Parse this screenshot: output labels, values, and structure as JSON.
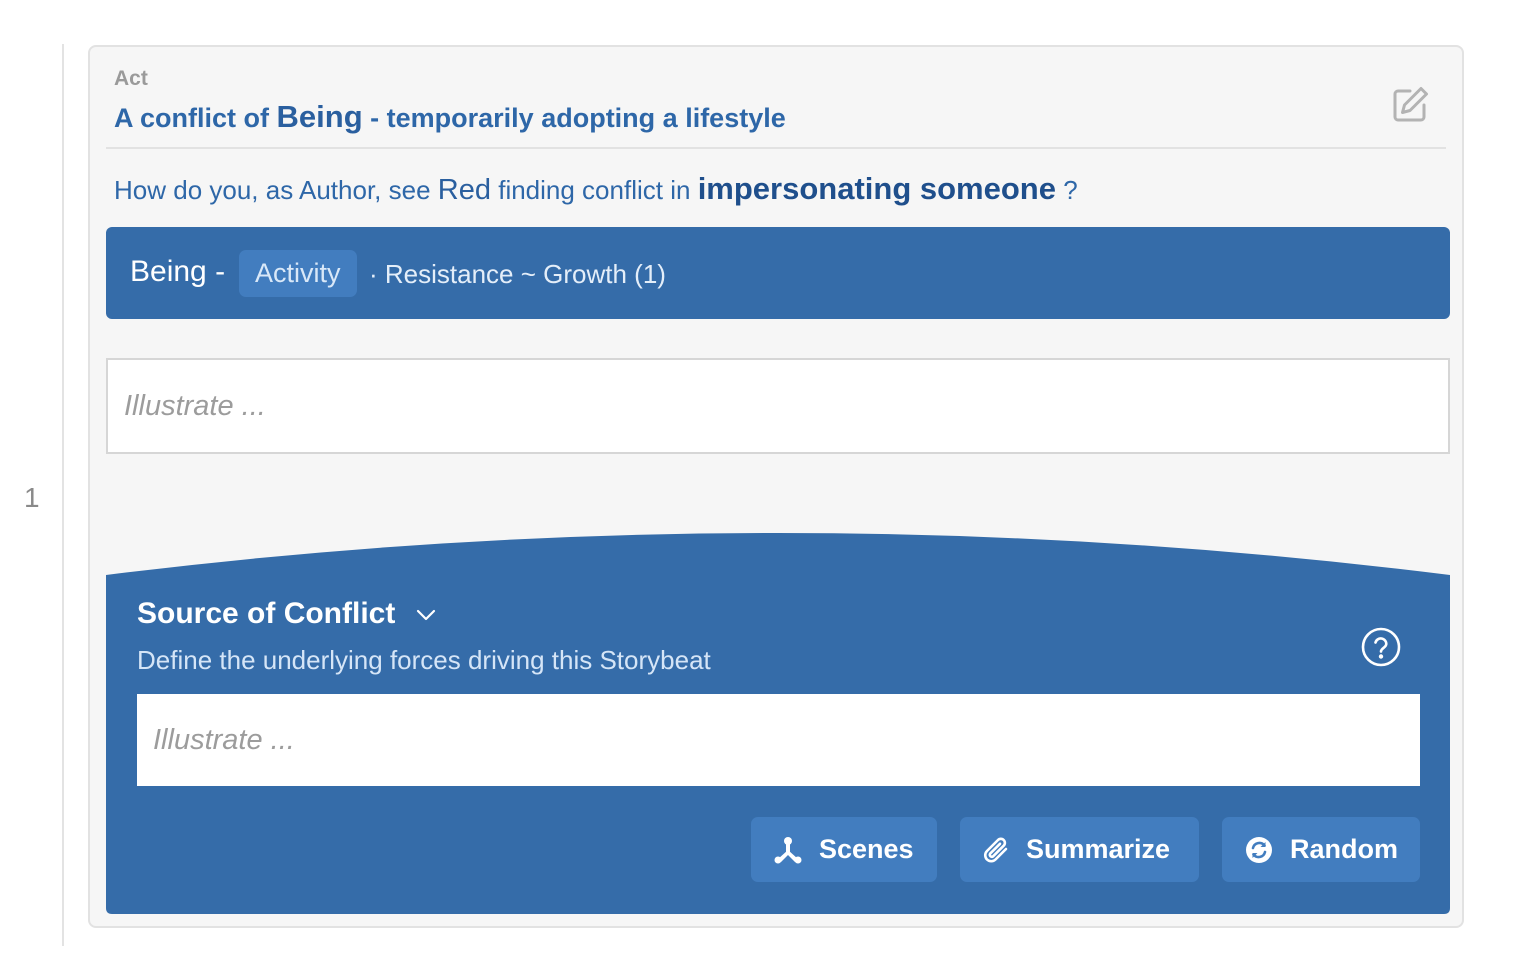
{
  "gutter": {
    "line_number": "1"
  },
  "act": {
    "label": "Act",
    "title_prefix": "A conflict of",
    "title_main": "Being",
    "title_suffix": "- temporarily adopting a lifestyle",
    "edit_icon": "edit-icon"
  },
  "question": {
    "prefix": "How do you, as Author, see",
    "character": "Red",
    "middle": "finding conflict in",
    "topic": "impersonating someone",
    "suffix": "?"
  },
  "being_bar": {
    "label": "Being -",
    "chip": "Activity",
    "detail": "· Resistance ~ Growth (1)"
  },
  "illustrate_top": {
    "placeholder": "Illustrate ...",
    "value": ""
  },
  "source": {
    "title": "Source of Conflict",
    "subtitle": "Define the underlying forces driving this Storybeat",
    "illustrate": {
      "placeholder": "Illustrate ...",
      "value": ""
    },
    "help_icon": "help-circle-icon",
    "chevron_icon": "chevron-down-icon"
  },
  "buttons": {
    "scenes": "Scenes",
    "summarize": "Summarize",
    "random": "Random"
  },
  "colors": {
    "card_bg": "#f6f6f6",
    "primary": "#356ca9",
    "button_bg": "#427dbf",
    "title_text": "#2e67a8"
  }
}
